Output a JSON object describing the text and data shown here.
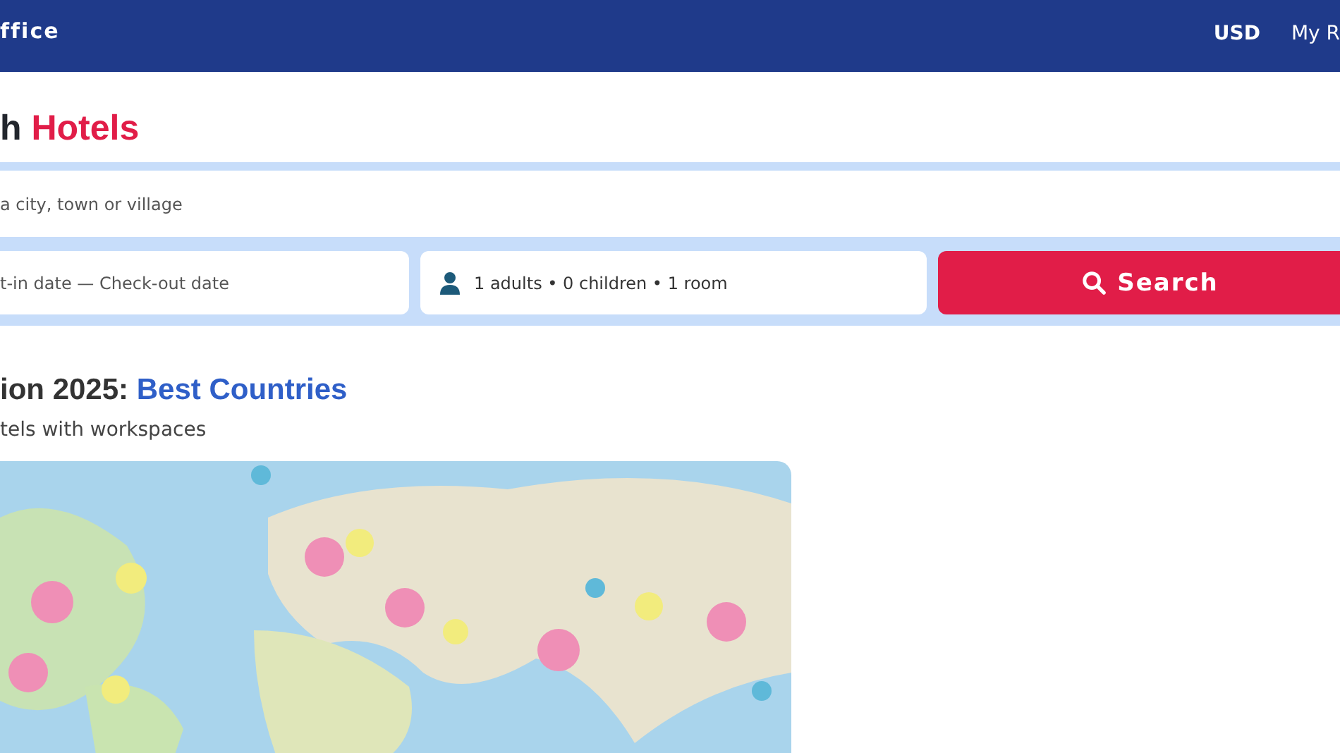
{
  "header": {
    "brand": "ffice",
    "currency": "USD",
    "account_link": "My R"
  },
  "title": {
    "lead": "h",
    "highlight": "Hotels"
  },
  "search": {
    "destination": {
      "placeholder": "a city, town or village"
    },
    "dates": {
      "placeholder": "t-in date — Check-out date"
    },
    "guests": {
      "value": "1 adults • 0 children • 1 room"
    },
    "button": "Search"
  },
  "section": {
    "lead": "ion 2025:",
    "highlight": "Best Countries",
    "subtitle": "tels with workspaces"
  }
}
